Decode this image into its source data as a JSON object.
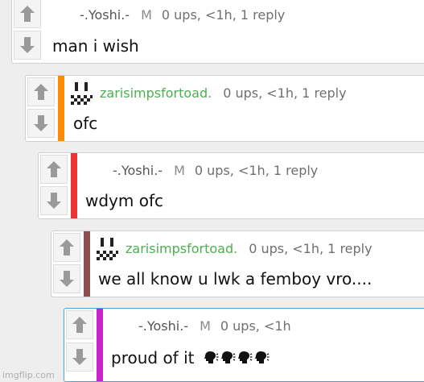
{
  "colors": {
    "page_bg": "#eeeeee",
    "card_bg": "#ffffff",
    "stripe_orange": "#ff8c00",
    "stripe_red": "#ee3333",
    "stripe_brown": "#8b4f4f",
    "stripe_magenta": "#cc22cc",
    "author_green": "#4caf50"
  },
  "comments": [
    {
      "author": "-.Yoshi.-",
      "mod": "M",
      "meta": "0 ups, <1h, 1 reply",
      "text": "man i wish"
    },
    {
      "author": "zarisimpsfortoad.",
      "meta": "0 ups, <1h, 1 reply",
      "text": "ofc"
    },
    {
      "author": "-.Yoshi.-",
      "mod": "M",
      "meta": "0 ups, <1h, 1 reply",
      "text": "wdym ofc"
    },
    {
      "author": "zarisimpsfortoad.",
      "meta": "0 ups, <1h, 1 reply",
      "text": "we all know u lwk a femboy vro...."
    },
    {
      "author": "-.Yoshi.-",
      "mod": "M",
      "meta": "0 ups, <1h",
      "text": "proud of it",
      "emoji_icons": [
        "speaking-head-icon",
        "speaking-head-icon",
        "speaking-head-icon",
        "speaking-head-icon"
      ]
    }
  ],
  "watermark": "imgflip.com"
}
